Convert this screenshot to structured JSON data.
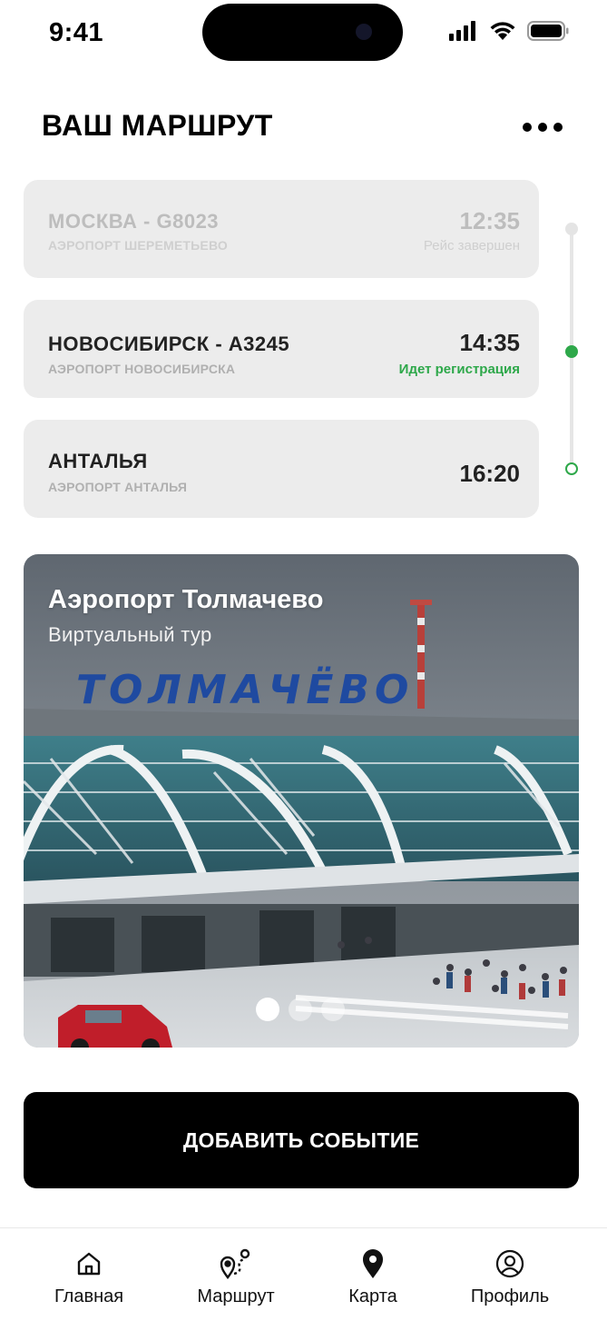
{
  "status_bar": {
    "time": "9:41"
  },
  "header": {
    "title": "ВАШ МАРШРУТ",
    "more_icon": "more-horizontal-icon"
  },
  "route": [
    {
      "city": "МОСКВА - G8023",
      "airport": "АЭРОПОРТ ШЕРЕМЕТЬЕВО",
      "time": "12:35",
      "status": "Рейс завершен",
      "state": "done"
    },
    {
      "city": "НОВОСИБИРСК - А3245",
      "airport": "АЭРОПОРТ НОВОСИБИРСКА",
      "time": "14:35",
      "status": "Идет регистрация",
      "state": "current"
    },
    {
      "city": "АНТАЛЬЯ",
      "airport": "АЭРОПОРТ АНТАЛЬЯ",
      "time": "16:20",
      "status": "",
      "state": "upcoming"
    }
  ],
  "colors": {
    "accent_green": "#2ea84a",
    "card_bg": "#ececec",
    "button_bg": "#000000"
  },
  "tour": {
    "title": "Аэропорт Толмачево",
    "subtitle": "Виртуальный тур",
    "sign_text": "ТОЛМАЧЁВО",
    "slides": 3,
    "active_slide": 1
  },
  "actions": {
    "add_event": "ДОБАВИТЬ СОБЫТИЕ"
  },
  "nav": [
    {
      "label": "Главная",
      "icon": "home-icon"
    },
    {
      "label": "Маршрут",
      "icon": "route-icon"
    },
    {
      "label": "Карта",
      "icon": "map-pin-icon"
    },
    {
      "label": "Профиль",
      "icon": "profile-icon"
    }
  ]
}
